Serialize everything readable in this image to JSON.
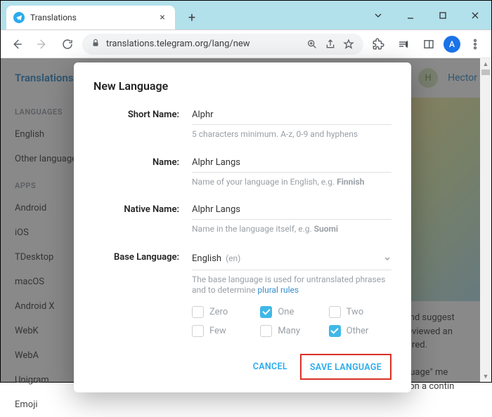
{
  "browser": {
    "tab_title": "Translations",
    "url": "translations.telegram.org/lang/new",
    "avatar_letter": "A"
  },
  "page": {
    "header_title": "Translations",
    "user_name": "Hector",
    "user_initial": "H",
    "sidebar": {
      "section_languages": "LANGUAGES",
      "lang_items": [
        "English",
        "Other languages..."
      ],
      "section_apps": "APPS",
      "app_items": [
        "Android",
        "iOS",
        "TDesktop",
        "macOS",
        "Android X",
        "WebK",
        "WebA",
        "Unigram",
        "Emoji"
      ]
    },
    "body_snippets": [
      "mprove and suggest",
      "ons are reviewed an",
      "ates required.",
      "the \"Language\" me",
      "anguage on a contin"
    ]
  },
  "modal": {
    "title": "New Language",
    "fields": {
      "short_name": {
        "label": "Short Name:",
        "value": "Alphr",
        "hint": "5 characters minimum. A-z, 0-9 and hyphens"
      },
      "name": {
        "label": "Name:",
        "value": "Alphr Langs",
        "hint_prefix": "Name of your language in English, e.g. ",
        "hint_bold": "Finnish"
      },
      "native_name": {
        "label": "Native Name:",
        "value": "Alphr Langs",
        "hint_prefix": "Name in the language itself, e.g. ",
        "hint_bold": "Suomi"
      },
      "base_language": {
        "label": "Base Language:",
        "value": "English",
        "sub": "(en)",
        "hint_prefix": "The base language is used for untranslated phrases and to determine ",
        "hint_link": "plural rules"
      }
    },
    "plural_checks": [
      {
        "label": "Zero",
        "checked": false
      },
      {
        "label": "One",
        "checked": true
      },
      {
        "label": "Two",
        "checked": false
      },
      {
        "label": "Few",
        "checked": false
      },
      {
        "label": "Many",
        "checked": false
      },
      {
        "label": "Other",
        "checked": true
      }
    ],
    "actions": {
      "cancel": "CANCEL",
      "save": "SAVE LANGUAGE"
    }
  }
}
